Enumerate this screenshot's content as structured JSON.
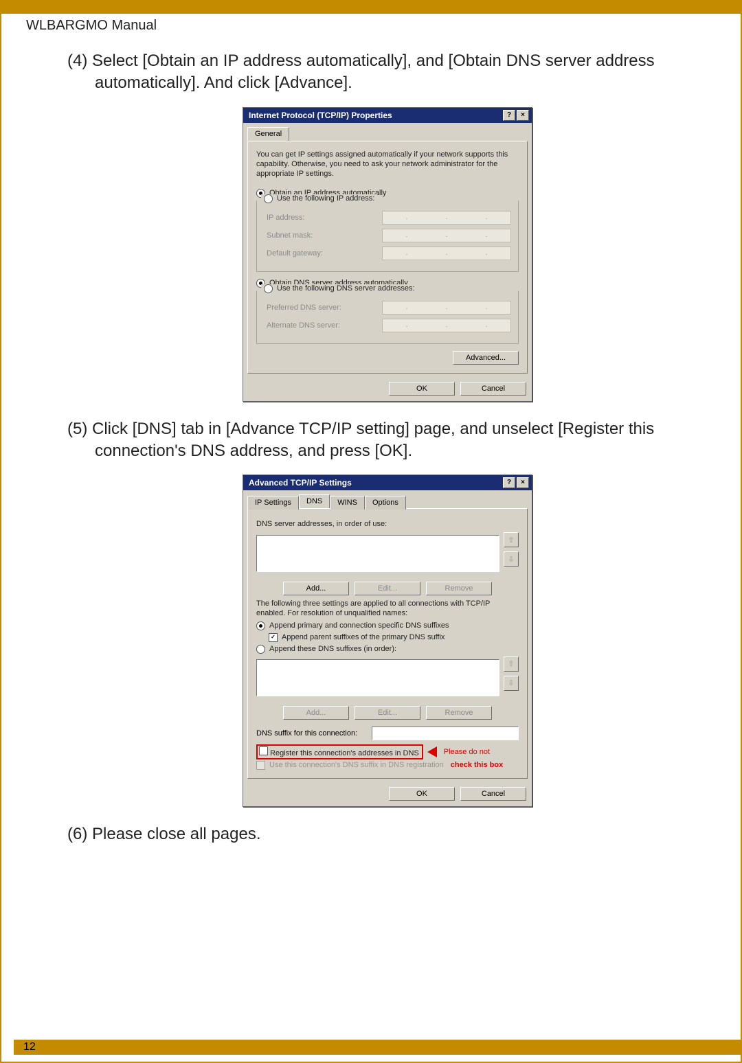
{
  "doc_header": "WLBARGMO Manual",
  "page_number": "12",
  "steps": {
    "s4": "(4) Select [Obtain an IP address automatically], and [Obtain DNS server address automatically]. And click [Advance].",
    "s5": "(5) Click [DNS] tab in [Advance TCP/IP setting] page, and unselect [Register this connection's DNS address, and press [OK].",
    "s6": "(6) Please close all pages."
  },
  "dlg1": {
    "title": "Internet Protocol (TCP/IP) Properties",
    "help_btn": "?",
    "close_btn": "×",
    "tab_general": "General",
    "desc": "You can get IP settings assigned automatically if your network supports this capability. Otherwise, you need to ask your network administrator for the appropriate IP settings.",
    "radio_obtain_ip": "Obtain an IP address automatically",
    "radio_use_ip": "Use the following IP address:",
    "lbl_ip": "IP address:",
    "lbl_mask": "Subnet mask:",
    "lbl_gw": "Default gateway:",
    "radio_obtain_dns": "Obtain DNS server address automatically",
    "radio_use_dns": "Use the following DNS server addresses:",
    "lbl_pref_dns": "Preferred DNS server:",
    "lbl_alt_dns": "Alternate DNS server:",
    "btn_advanced": "Advanced...",
    "btn_ok": "OK",
    "btn_cancel": "Cancel"
  },
  "dlg2": {
    "title": "Advanced TCP/IP Settings",
    "help_btn": "?",
    "close_btn": "×",
    "tab_ip": "IP Settings",
    "tab_dns": "DNS",
    "tab_wins": "WINS",
    "tab_options": "Options",
    "lbl_dns_order": "DNS server addresses, in order of use:",
    "btn_add": "Add...",
    "btn_edit": "Edit...",
    "btn_remove": "Remove",
    "desc_suffix": "The following three settings are applied to all connections with TCP/IP enabled. For resolution of unqualified names:",
    "radio_append_primary": "Append primary and connection specific DNS suffixes",
    "chk_append_parent": "Append parent suffixes of the primary DNS suffix",
    "radio_append_these": "Append these DNS suffixes (in order):",
    "lbl_dns_suffix": "DNS suffix for this connection:",
    "chk_register": "Register this connection's addresses in DNS",
    "chk_use_suffix": "Use this connection's DNS suffix in DNS registration",
    "callout_line1": "Please do not",
    "callout_line2": "check this box",
    "btn_ok": "OK",
    "btn_cancel": "Cancel",
    "arrow_up": "⇧",
    "arrow_down": "⇩"
  }
}
